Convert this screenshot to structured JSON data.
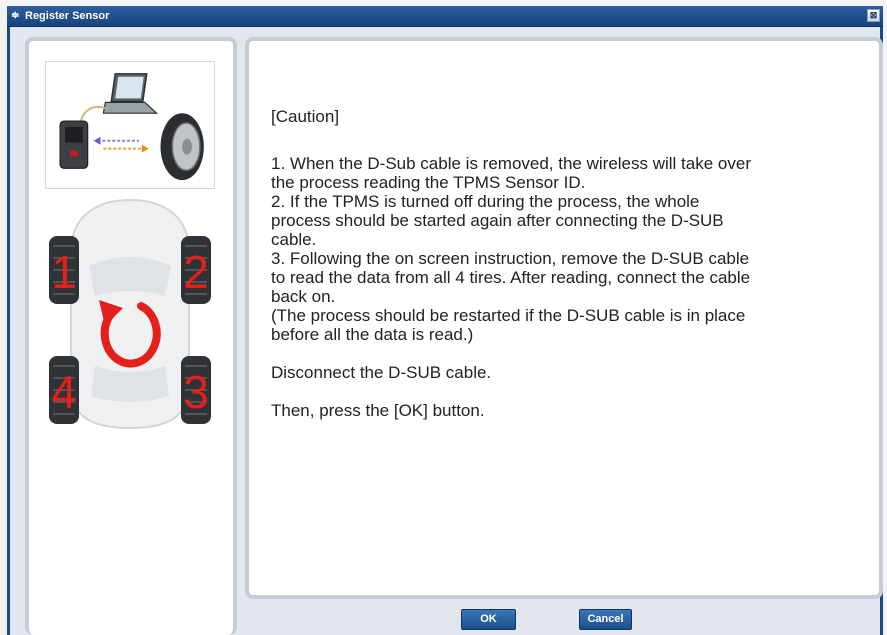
{
  "window": {
    "title": "Register Sensor",
    "close_glyph": "⊠"
  },
  "message": {
    "caution": "[Caution]",
    "lines": [
      "1. When the D-Sub cable is removed, the wireless will take over",
      "the process reading the TPMS Sensor ID.",
      "2. If the TPMS is turned off during the process, the whole",
      "process should be started again after connecting the D-SUB",
      "cable.",
      "3. Following the on screen instruction, remove the D-SUB cable",
      "to read the data from all 4 tires. After reading, connect the cable",
      "back on.",
      "(The process should be restarted if the D-SUB cable is in place",
      "before all the data is read.)"
    ],
    "instruction1": "Disconnect the D-SUB cable.",
    "instruction2": "Then, press the [OK] button."
  },
  "illustration": {
    "tire_numbers": [
      "1",
      "2",
      "3",
      "4"
    ],
    "icons": [
      "laptop-icon",
      "tpms-tool-icon",
      "tire-icon",
      "car-top-view-icon",
      "rotation-arrow-icon"
    ],
    "accent_color": "#e3201b"
  },
  "buttons": {
    "ok_label": "OK",
    "cancel_label": "Cancel"
  },
  "colors": {
    "titlebar": "#1f4f8f",
    "button": "#2a62a3"
  }
}
